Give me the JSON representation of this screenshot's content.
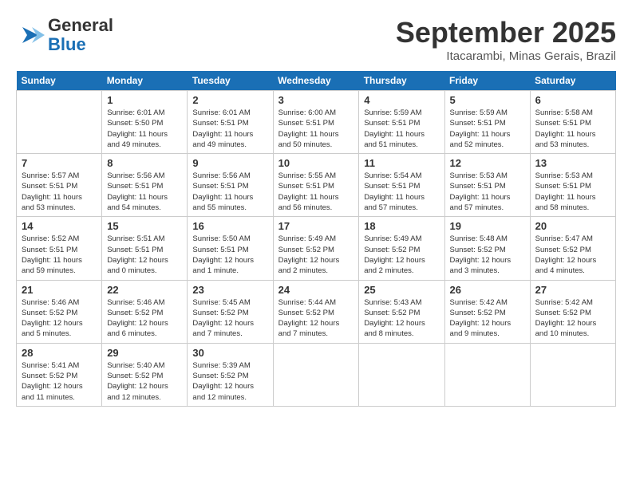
{
  "header": {
    "logo_general": "General",
    "logo_blue": "Blue",
    "month": "September 2025",
    "location": "Itacarambi, Minas Gerais, Brazil"
  },
  "weekdays": [
    "Sunday",
    "Monday",
    "Tuesday",
    "Wednesday",
    "Thursday",
    "Friday",
    "Saturday"
  ],
  "weeks": [
    [
      {
        "day": "",
        "info": ""
      },
      {
        "day": "1",
        "info": "Sunrise: 6:01 AM\nSunset: 5:50 PM\nDaylight: 11 hours\nand 49 minutes."
      },
      {
        "day": "2",
        "info": "Sunrise: 6:01 AM\nSunset: 5:51 PM\nDaylight: 11 hours\nand 49 minutes."
      },
      {
        "day": "3",
        "info": "Sunrise: 6:00 AM\nSunset: 5:51 PM\nDaylight: 11 hours\nand 50 minutes."
      },
      {
        "day": "4",
        "info": "Sunrise: 5:59 AM\nSunset: 5:51 PM\nDaylight: 11 hours\nand 51 minutes."
      },
      {
        "day": "5",
        "info": "Sunrise: 5:59 AM\nSunset: 5:51 PM\nDaylight: 11 hours\nand 52 minutes."
      },
      {
        "day": "6",
        "info": "Sunrise: 5:58 AM\nSunset: 5:51 PM\nDaylight: 11 hours\nand 53 minutes."
      }
    ],
    [
      {
        "day": "7",
        "info": "Sunrise: 5:57 AM\nSunset: 5:51 PM\nDaylight: 11 hours\nand 53 minutes."
      },
      {
        "day": "8",
        "info": "Sunrise: 5:56 AM\nSunset: 5:51 PM\nDaylight: 11 hours\nand 54 minutes."
      },
      {
        "day": "9",
        "info": "Sunrise: 5:56 AM\nSunset: 5:51 PM\nDaylight: 11 hours\nand 55 minutes."
      },
      {
        "day": "10",
        "info": "Sunrise: 5:55 AM\nSunset: 5:51 PM\nDaylight: 11 hours\nand 56 minutes."
      },
      {
        "day": "11",
        "info": "Sunrise: 5:54 AM\nSunset: 5:51 PM\nDaylight: 11 hours\nand 57 minutes."
      },
      {
        "day": "12",
        "info": "Sunrise: 5:53 AM\nSunset: 5:51 PM\nDaylight: 11 hours\nand 57 minutes."
      },
      {
        "day": "13",
        "info": "Sunrise: 5:53 AM\nSunset: 5:51 PM\nDaylight: 11 hours\nand 58 minutes."
      }
    ],
    [
      {
        "day": "14",
        "info": "Sunrise: 5:52 AM\nSunset: 5:51 PM\nDaylight: 11 hours\nand 59 minutes."
      },
      {
        "day": "15",
        "info": "Sunrise: 5:51 AM\nSunset: 5:51 PM\nDaylight: 12 hours\nand 0 minutes."
      },
      {
        "day": "16",
        "info": "Sunrise: 5:50 AM\nSunset: 5:51 PM\nDaylight: 12 hours\nand 1 minute."
      },
      {
        "day": "17",
        "info": "Sunrise: 5:49 AM\nSunset: 5:52 PM\nDaylight: 12 hours\nand 2 minutes."
      },
      {
        "day": "18",
        "info": "Sunrise: 5:49 AM\nSunset: 5:52 PM\nDaylight: 12 hours\nand 2 minutes."
      },
      {
        "day": "19",
        "info": "Sunrise: 5:48 AM\nSunset: 5:52 PM\nDaylight: 12 hours\nand 3 minutes."
      },
      {
        "day": "20",
        "info": "Sunrise: 5:47 AM\nSunset: 5:52 PM\nDaylight: 12 hours\nand 4 minutes."
      }
    ],
    [
      {
        "day": "21",
        "info": "Sunrise: 5:46 AM\nSunset: 5:52 PM\nDaylight: 12 hours\nand 5 minutes."
      },
      {
        "day": "22",
        "info": "Sunrise: 5:46 AM\nSunset: 5:52 PM\nDaylight: 12 hours\nand 6 minutes."
      },
      {
        "day": "23",
        "info": "Sunrise: 5:45 AM\nSunset: 5:52 PM\nDaylight: 12 hours\nand 7 minutes."
      },
      {
        "day": "24",
        "info": "Sunrise: 5:44 AM\nSunset: 5:52 PM\nDaylight: 12 hours\nand 7 minutes."
      },
      {
        "day": "25",
        "info": "Sunrise: 5:43 AM\nSunset: 5:52 PM\nDaylight: 12 hours\nand 8 minutes."
      },
      {
        "day": "26",
        "info": "Sunrise: 5:42 AM\nSunset: 5:52 PM\nDaylight: 12 hours\nand 9 minutes."
      },
      {
        "day": "27",
        "info": "Sunrise: 5:42 AM\nSunset: 5:52 PM\nDaylight: 12 hours\nand 10 minutes."
      }
    ],
    [
      {
        "day": "28",
        "info": "Sunrise: 5:41 AM\nSunset: 5:52 PM\nDaylight: 12 hours\nand 11 minutes."
      },
      {
        "day": "29",
        "info": "Sunrise: 5:40 AM\nSunset: 5:52 PM\nDaylight: 12 hours\nand 12 minutes."
      },
      {
        "day": "30",
        "info": "Sunrise: 5:39 AM\nSunset: 5:52 PM\nDaylight: 12 hours\nand 12 minutes."
      },
      {
        "day": "",
        "info": ""
      },
      {
        "day": "",
        "info": ""
      },
      {
        "day": "",
        "info": ""
      },
      {
        "day": "",
        "info": ""
      }
    ]
  ]
}
